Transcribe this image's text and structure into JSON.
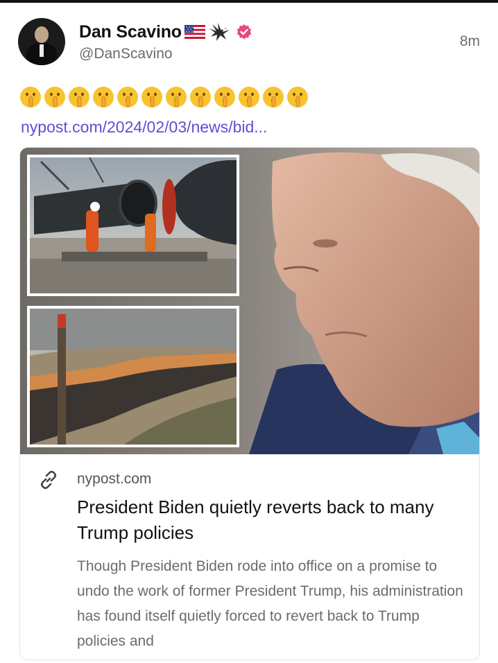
{
  "author": {
    "name": "Dan Scavino",
    "handle": "@DanScavino",
    "badge_icons": [
      "us-flag-icon",
      "eagle-icon",
      "verified-badge-icon"
    ]
  },
  "post": {
    "time": "8m",
    "emojis": [
      "shushing-face",
      "shushing-face",
      "shushing-face",
      "shushing-face",
      "shushing-face",
      "shushing-face",
      "shushing-face",
      "shushing-face",
      "shushing-face",
      "shushing-face",
      "shushing-face",
      "shushing-face"
    ],
    "link_text": "nypost.com/2024/02/03/news/bid..."
  },
  "link_card": {
    "domain": "nypost.com",
    "headline": "President Biden quietly reverts back to many Trump policies",
    "description": "Though President Biden rode into office on a promise to undo the work of former President Trump, his administration has found itself quietly forced to revert back to Trump policies and",
    "icon": "link-icon"
  },
  "colors": {
    "link": "#5b4fd6",
    "verified": "#e8487a",
    "secondary_text": "#6b6b6b"
  }
}
